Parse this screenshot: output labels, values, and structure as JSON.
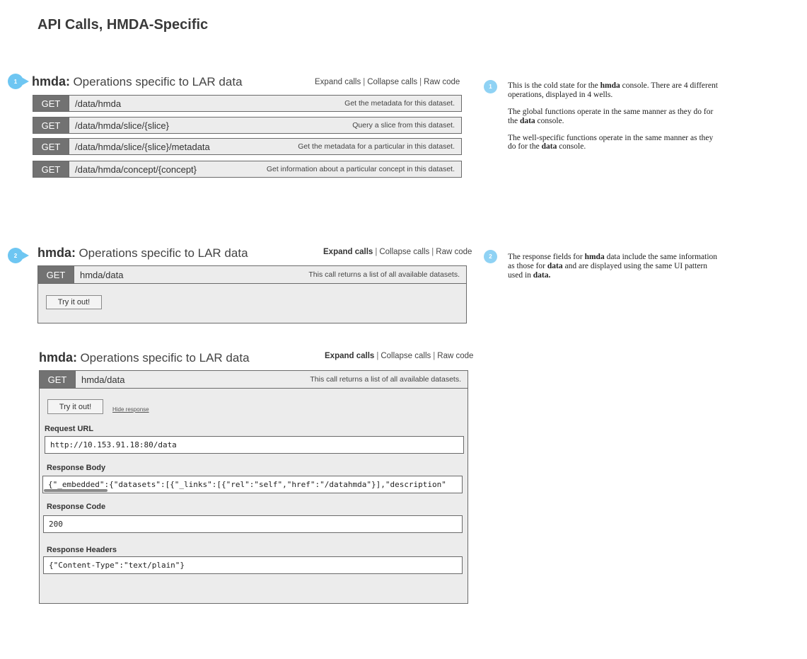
{
  "page_title": "API Calls, HMDA-Specific",
  "colors": {
    "marker": "#6ec6f2",
    "method_bg": "#727272",
    "panel_bg": "#ececec"
  },
  "section1": {
    "marker": "1",
    "name": "hmda:",
    "description": "Operations specific to LAR data",
    "links": {
      "expand": "Expand calls",
      "collapse": "Collapse calls",
      "raw": "Raw code"
    },
    "operations": [
      {
        "method": "GET",
        "path": "/data/hmda",
        "summary": "Get the metadata for this dataset."
      },
      {
        "method": "GET",
        "path": "/data/hmda/slice/{slice}",
        "summary": "Query a slice from this dataset."
      },
      {
        "method": "GET",
        "path": "/data/hmda/slice/{slice}/metadata",
        "summary": "Get the metadata for a particular in this dataset."
      },
      {
        "method": "GET",
        "path": "/data/hmda/concept/{concept}",
        "summary": "Get information about a particular concept in this dataset."
      }
    ]
  },
  "section2": {
    "marker": "2",
    "name": "hmda:",
    "description": "Operations specific to LAR data",
    "links": {
      "expand": "Expand calls",
      "collapse": "Collapse calls",
      "raw": "Raw code"
    },
    "operation": {
      "method": "GET",
      "path": "hmda/data",
      "summary": "This call returns a list of all available datasets."
    },
    "try_button": "Try it out!"
  },
  "section3": {
    "name": "hmda:",
    "description": "Operations specific to LAR data",
    "links": {
      "expand": "Expand calls",
      "collapse": "Collapse calls",
      "raw": "Raw code"
    },
    "operation": {
      "method": "GET",
      "path": "hmda/data",
      "summary": "This call returns a list of all available datasets."
    },
    "try_button": "Try it out!",
    "hide_response": "Hide response",
    "request_url_label": "Request URL",
    "request_url": "http://10.153.91.18:80/data",
    "response_body_label": "Response Body",
    "response_body": "{\"_embedded\":{\"datasets\":[{\"_links\":[{\"rel\":\"self\",\"href\":\"/datahmda\"}],\"description\"",
    "response_code_label": "Response Code",
    "response_code": "200",
    "response_headers_label": "Response Headers",
    "response_headers": "{\"Content-Type\":\"text/plain\"}"
  },
  "notes1": {
    "marker": "1",
    "p1": {
      "a": "This is the cold state for the ",
      "b": "hmda",
      "c": " console. There are 4 different operations, displayed in 4 wells."
    },
    "p2": {
      "a": "The global functions operate in the same manner as they do for the ",
      "b": "data",
      "c": " console."
    },
    "p3": {
      "a": "The well-specific functions operate in the same manner as they do for the ",
      "b": "data",
      "c": " console."
    }
  },
  "notes2": {
    "marker": "2",
    "p1": {
      "a": "The response fields for ",
      "b": "hmda",
      "c": " data include the same information as those for ",
      "d": "data",
      "e": " and are displayed using the same UI pattern used in ",
      "f": "data."
    }
  }
}
